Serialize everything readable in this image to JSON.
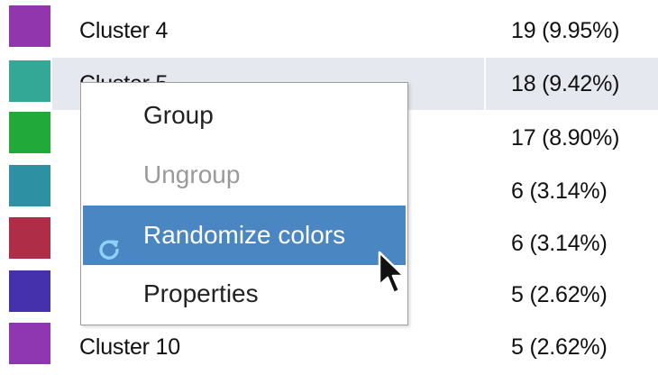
{
  "table": {
    "rows": [
      {
        "name": "Cluster 4",
        "count": "19 (9.95%)",
        "color": "#9136ad"
      },
      {
        "name": "Cluster 5",
        "count": "18 (9.42%)",
        "color": "#33a896"
      },
      {
        "name": "",
        "count": "17 (8.90%)",
        "color": "#21a93a"
      },
      {
        "name": "",
        "count": "6 (3.14%)",
        "color": "#2e91a3"
      },
      {
        "name": "",
        "count": "6 (3.14%)",
        "color": "#b02d48"
      },
      {
        "name": "",
        "count": "5 (2.62%)",
        "color": "#4631ad"
      },
      {
        "name": "Cluster 10",
        "count": "5 (2.62%)",
        "color": "#8f37b0"
      }
    ]
  },
  "context_menu": {
    "items": [
      {
        "label": "Group",
        "state": "normal"
      },
      {
        "label": "Ungroup",
        "state": "disabled"
      },
      {
        "label": "Randomize colors",
        "state": "highlighted",
        "icon": "refresh-icon"
      },
      {
        "label": "Properties",
        "state": "normal"
      }
    ],
    "highlight_color": "#4a87c2"
  }
}
